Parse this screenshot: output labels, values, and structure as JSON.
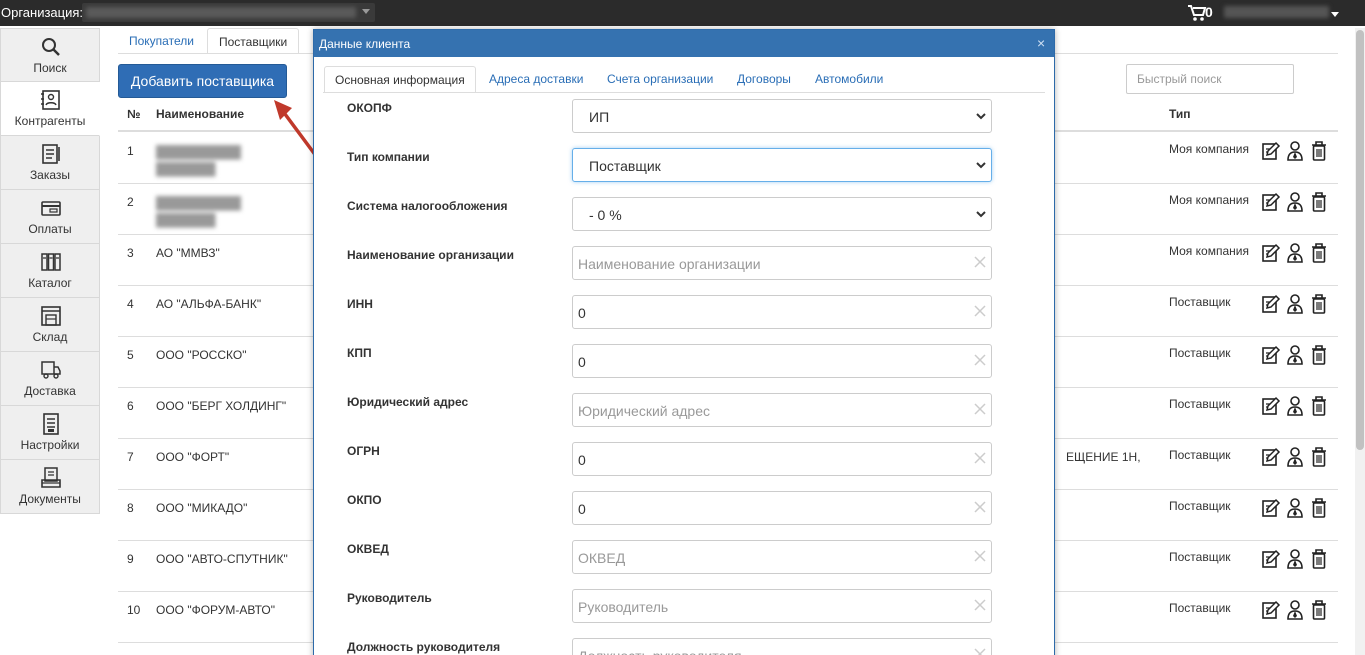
{
  "topbar": {
    "org_label": "Организация:",
    "cart_count": "0"
  },
  "sidebar": {
    "items": [
      {
        "label": "Поиск",
        "icon": "search-icon"
      },
      {
        "label": "Контрагенты",
        "icon": "contacts-icon"
      },
      {
        "label": "Заказы",
        "icon": "orders-icon"
      },
      {
        "label": "Оплаты",
        "icon": "payments-icon"
      },
      {
        "label": "Каталог",
        "icon": "catalog-icon"
      },
      {
        "label": "Склад",
        "icon": "warehouse-icon"
      },
      {
        "label": "Доставка",
        "icon": "delivery-icon"
      },
      {
        "label": "Настройки",
        "icon": "settings-icon"
      },
      {
        "label": "Документы",
        "icon": "documents-icon"
      }
    ],
    "active_index": 1
  },
  "tabs": [
    "Покупатели",
    "Поставщики"
  ],
  "add_button": "Добавить поставщика",
  "quick_search_placeholder": "Быстрый поиск",
  "table": {
    "headers": {
      "num": "№",
      "name": "Наименование",
      "type": "Тип"
    },
    "rows": [
      {
        "num": "1",
        "name": "",
        "type": "Моя компания",
        "addr": ""
      },
      {
        "num": "2",
        "name": "",
        "type": "Моя компания",
        "addr": ""
      },
      {
        "num": "3",
        "name": "АО \"ММВЗ\"",
        "type": "Моя компания",
        "addr": ""
      },
      {
        "num": "4",
        "name": "АО \"АЛЬФА-БАНК\"",
        "type": "Поставщик",
        "addr": ""
      },
      {
        "num": "5",
        "name": "ООО \"РОССКО\"",
        "type": "Поставщик",
        "addr": ""
      },
      {
        "num": "6",
        "name": "ООО \"БЕРГ ХОЛДИНГ\"",
        "type": "Поставщик",
        "addr": ""
      },
      {
        "num": "7",
        "name": "ООО \"ФОРТ\"",
        "type": "Поставщик",
        "addr": "ЕЩЕНИЕ 1Н,"
      },
      {
        "num": "8",
        "name": "ООО \"МИКАДО\"",
        "type": "Поставщик",
        "addr": ""
      },
      {
        "num": "9",
        "name": "ООО \"АВТО-СПУТНИК\"",
        "type": "Поставщик",
        "addr": ""
      },
      {
        "num": "10",
        "name": "ООО \"ФОРУМ-АВТО\"",
        "type": "Поставщик",
        "addr": ""
      }
    ]
  },
  "modal": {
    "title": "Данные клиента",
    "tabs": [
      "Основная информация",
      "Адреса доставки",
      "Счета организации",
      "Договоры",
      "Автомобили"
    ],
    "fields": [
      {
        "label": "ОКОПФ",
        "kind": "select",
        "value": "ИП"
      },
      {
        "label": "Тип компании",
        "kind": "select",
        "value": "Поставщик"
      },
      {
        "label": "Система налогообложения",
        "kind": "select",
        "value": "- 0 %"
      },
      {
        "label": "Наименование организации",
        "kind": "input",
        "value": "",
        "placeholder": "Наименование организации"
      },
      {
        "label": "ИНН",
        "kind": "input",
        "value": "0",
        "placeholder": ""
      },
      {
        "label": "КПП",
        "kind": "input",
        "value": "0",
        "placeholder": ""
      },
      {
        "label": "Юридический адрес",
        "kind": "input",
        "value": "",
        "placeholder": "Юридический адрес"
      },
      {
        "label": "ОГРН",
        "kind": "input",
        "value": "0",
        "placeholder": ""
      },
      {
        "label": "ОКПО",
        "kind": "input",
        "value": "0",
        "placeholder": ""
      },
      {
        "label": "ОКВЕД",
        "kind": "input",
        "value": "",
        "placeholder": "ОКВЕД"
      },
      {
        "label": "Руководитель",
        "kind": "input",
        "value": "",
        "placeholder": "Руководитель"
      },
      {
        "label": "Должность руководителя",
        "kind": "input",
        "value": "",
        "placeholder": "Должность руководителя"
      }
    ]
  },
  "colors": {
    "accent": "#3572b0",
    "link": "#2a6eb6",
    "arrow": "#c0392b"
  }
}
